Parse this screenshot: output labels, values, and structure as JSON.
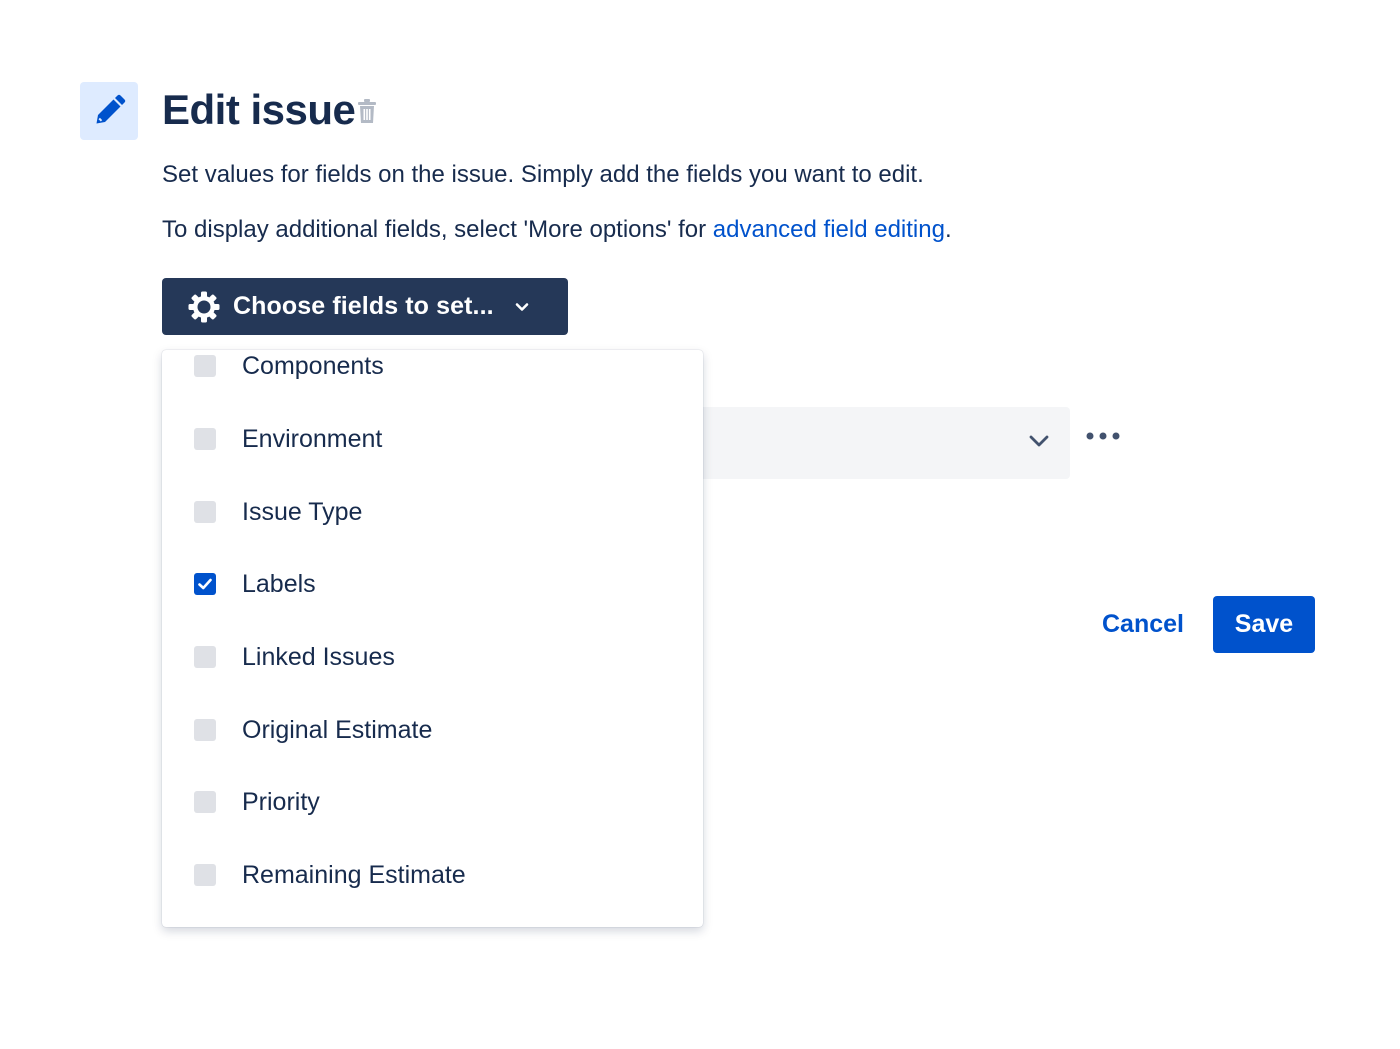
{
  "header": {
    "title": "Edit issue",
    "icon": "pencil-icon",
    "delete_icon": "trash-icon"
  },
  "description": {
    "line1": "Set values for fields on the issue. Simply add the fields you want to edit.",
    "line2_prefix": "To display additional fields, select 'More options' for ",
    "line2_link": "advanced field editing",
    "line2_suffix": "."
  },
  "choose_fields": {
    "label": "Choose fields to set...",
    "icon": "gear-icon",
    "chevron": "chevron-down-icon"
  },
  "field_options": [
    {
      "label": "Components",
      "checked": false
    },
    {
      "label": "Environment",
      "checked": false
    },
    {
      "label": "Issue Type",
      "checked": false
    },
    {
      "label": "Labels",
      "checked": true
    },
    {
      "label": "Linked Issues",
      "checked": false
    },
    {
      "label": "Original Estimate",
      "checked": false
    },
    {
      "label": "Priority",
      "checked": false
    },
    {
      "label": "Remaining Estimate",
      "checked": false
    }
  ],
  "footer": {
    "cancel_label": "Cancel",
    "save_label": "Save"
  },
  "colors": {
    "primary": "#0052cc",
    "dark_button": "#253858",
    "text": "#172b4d",
    "icon_bg": "#deebff",
    "checkbox_unchecked": "#dfe1e6"
  }
}
